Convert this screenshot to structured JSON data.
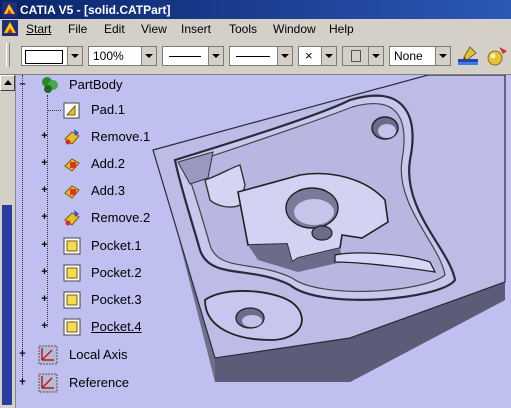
{
  "window": {
    "title": "CATIA V5 - [solid.CATPart]"
  },
  "menu": {
    "start": "Start",
    "file": "File",
    "edit": "Edit",
    "view": "View",
    "insert": "Insert",
    "tools": "Tools",
    "window": "Window",
    "help": "Help"
  },
  "toolbar": {
    "zoom_value": "100%",
    "point_symbol": "×",
    "layer_value": "None"
  },
  "tree": {
    "root": "PartBody",
    "items": [
      {
        "label": "Pad.1",
        "icon": "pad-icon"
      },
      {
        "label": "Remove.1",
        "icon": "remove-icon"
      },
      {
        "label": "Add.2",
        "icon": "add-icon"
      },
      {
        "label": "Add.3",
        "icon": "add-icon"
      },
      {
        "label": "Remove.2",
        "icon": "remove-icon"
      },
      {
        "label": "Pocket.1",
        "icon": "pocket-icon"
      },
      {
        "label": "Pocket.2",
        "icon": "pocket-icon"
      },
      {
        "label": "Pocket.3",
        "icon": "pocket-icon"
      },
      {
        "label": "Pocket.4",
        "icon": "pocket-icon"
      }
    ],
    "local_axis": "Local Axis",
    "reference": "Reference"
  },
  "colors": {
    "background": "#bfbff0",
    "titlebar": "#0a246a",
    "model_top": "#bcbce6",
    "model_side": "#6f6f8a"
  }
}
